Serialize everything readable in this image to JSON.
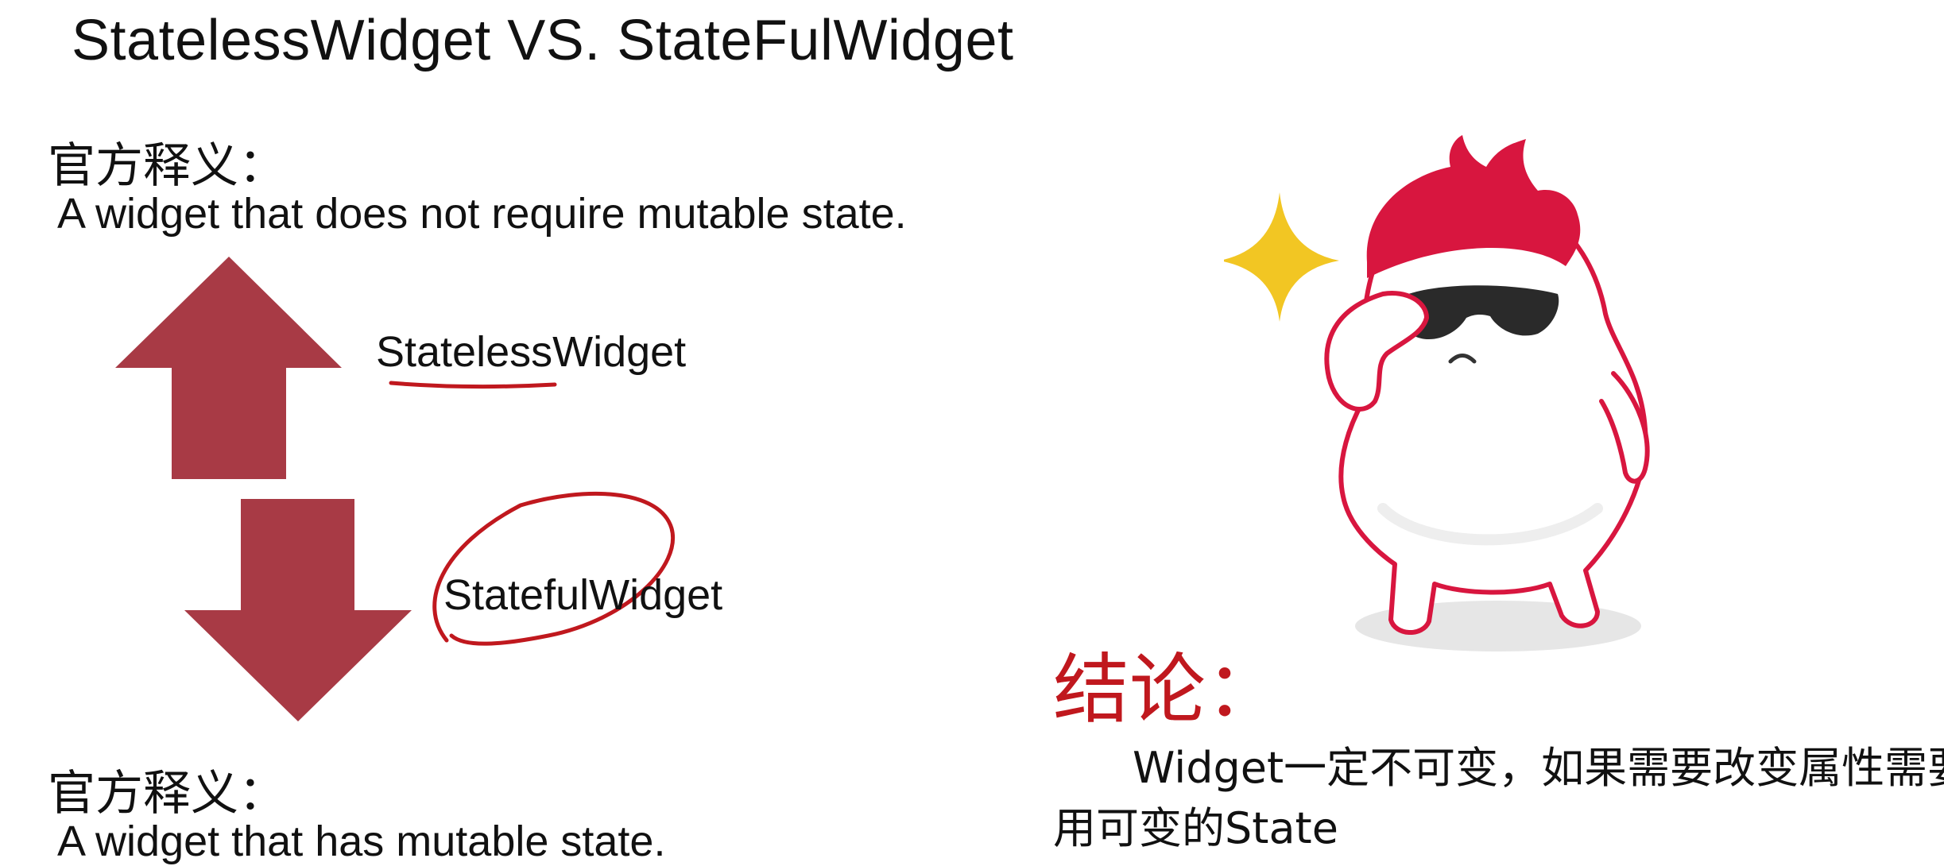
{
  "slide": {
    "title": "StatelessWidget VS. StateFulWidget",
    "stateless": {
      "heading": "官方释义：",
      "definition": "A widget that does not require mutable state.",
      "label": "StatelessWidget"
    },
    "stateful": {
      "heading": "官方释义：",
      "definition": "A widget that has mutable state.",
      "label": "StatefulWidget"
    },
    "conclusion": {
      "heading": "结论：",
      "line1": "Widget一定不可变，如果需要改变属性需要",
      "line2": "用可变的State"
    }
  },
  "colors": {
    "arrow": "#a83a45",
    "annotation": "#c0181e",
    "mascot_hair": "#d8163f",
    "sparkle": "#f2c623"
  },
  "icons": {
    "up_arrow": "up-arrow-icon",
    "down_arrow": "down-arrow-icon",
    "mascot": "cool-mascot-illustration",
    "sparkle": "sparkle-icon"
  }
}
